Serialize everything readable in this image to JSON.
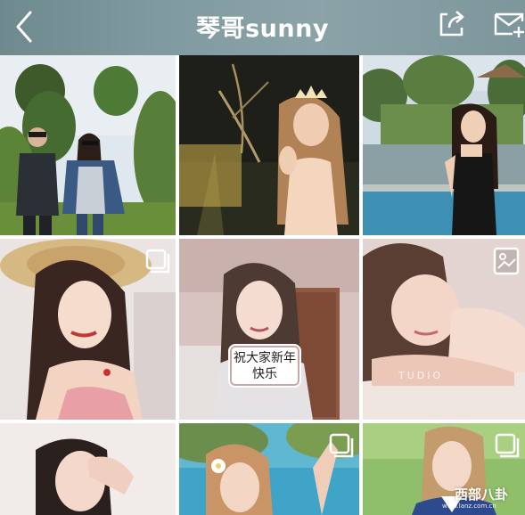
{
  "header": {
    "title": "琴哥sunny",
    "icons": {
      "back": "chevron-left-icon",
      "share": "share-icon",
      "message": "message-add-icon"
    }
  },
  "grid": {
    "tiles": [
      {
        "name": "tile-1",
        "badge": null
      },
      {
        "name": "tile-2",
        "badge": null
      },
      {
        "name": "tile-3",
        "badge": null
      },
      {
        "name": "tile-4",
        "badge": "multi-image-icon"
      },
      {
        "name": "tile-5",
        "badge": null,
        "caption": "祝大家新年快乐"
      },
      {
        "name": "tile-6",
        "badge": "image-icon",
        "overlay_text": "TUDIO"
      },
      {
        "name": "tile-7",
        "badge": null
      },
      {
        "name": "tile-8",
        "badge": "multi-image-icon"
      },
      {
        "name": "tile-9",
        "badge": "multi-image-icon"
      }
    ]
  },
  "watermark": {
    "text": "西部八卦",
    "url": "www.lanz.com.cn"
  },
  "colors": {
    "header_start": "#6f8a8e",
    "header_end": "#7d969c",
    "caption_border": "#c9a7a9"
  }
}
